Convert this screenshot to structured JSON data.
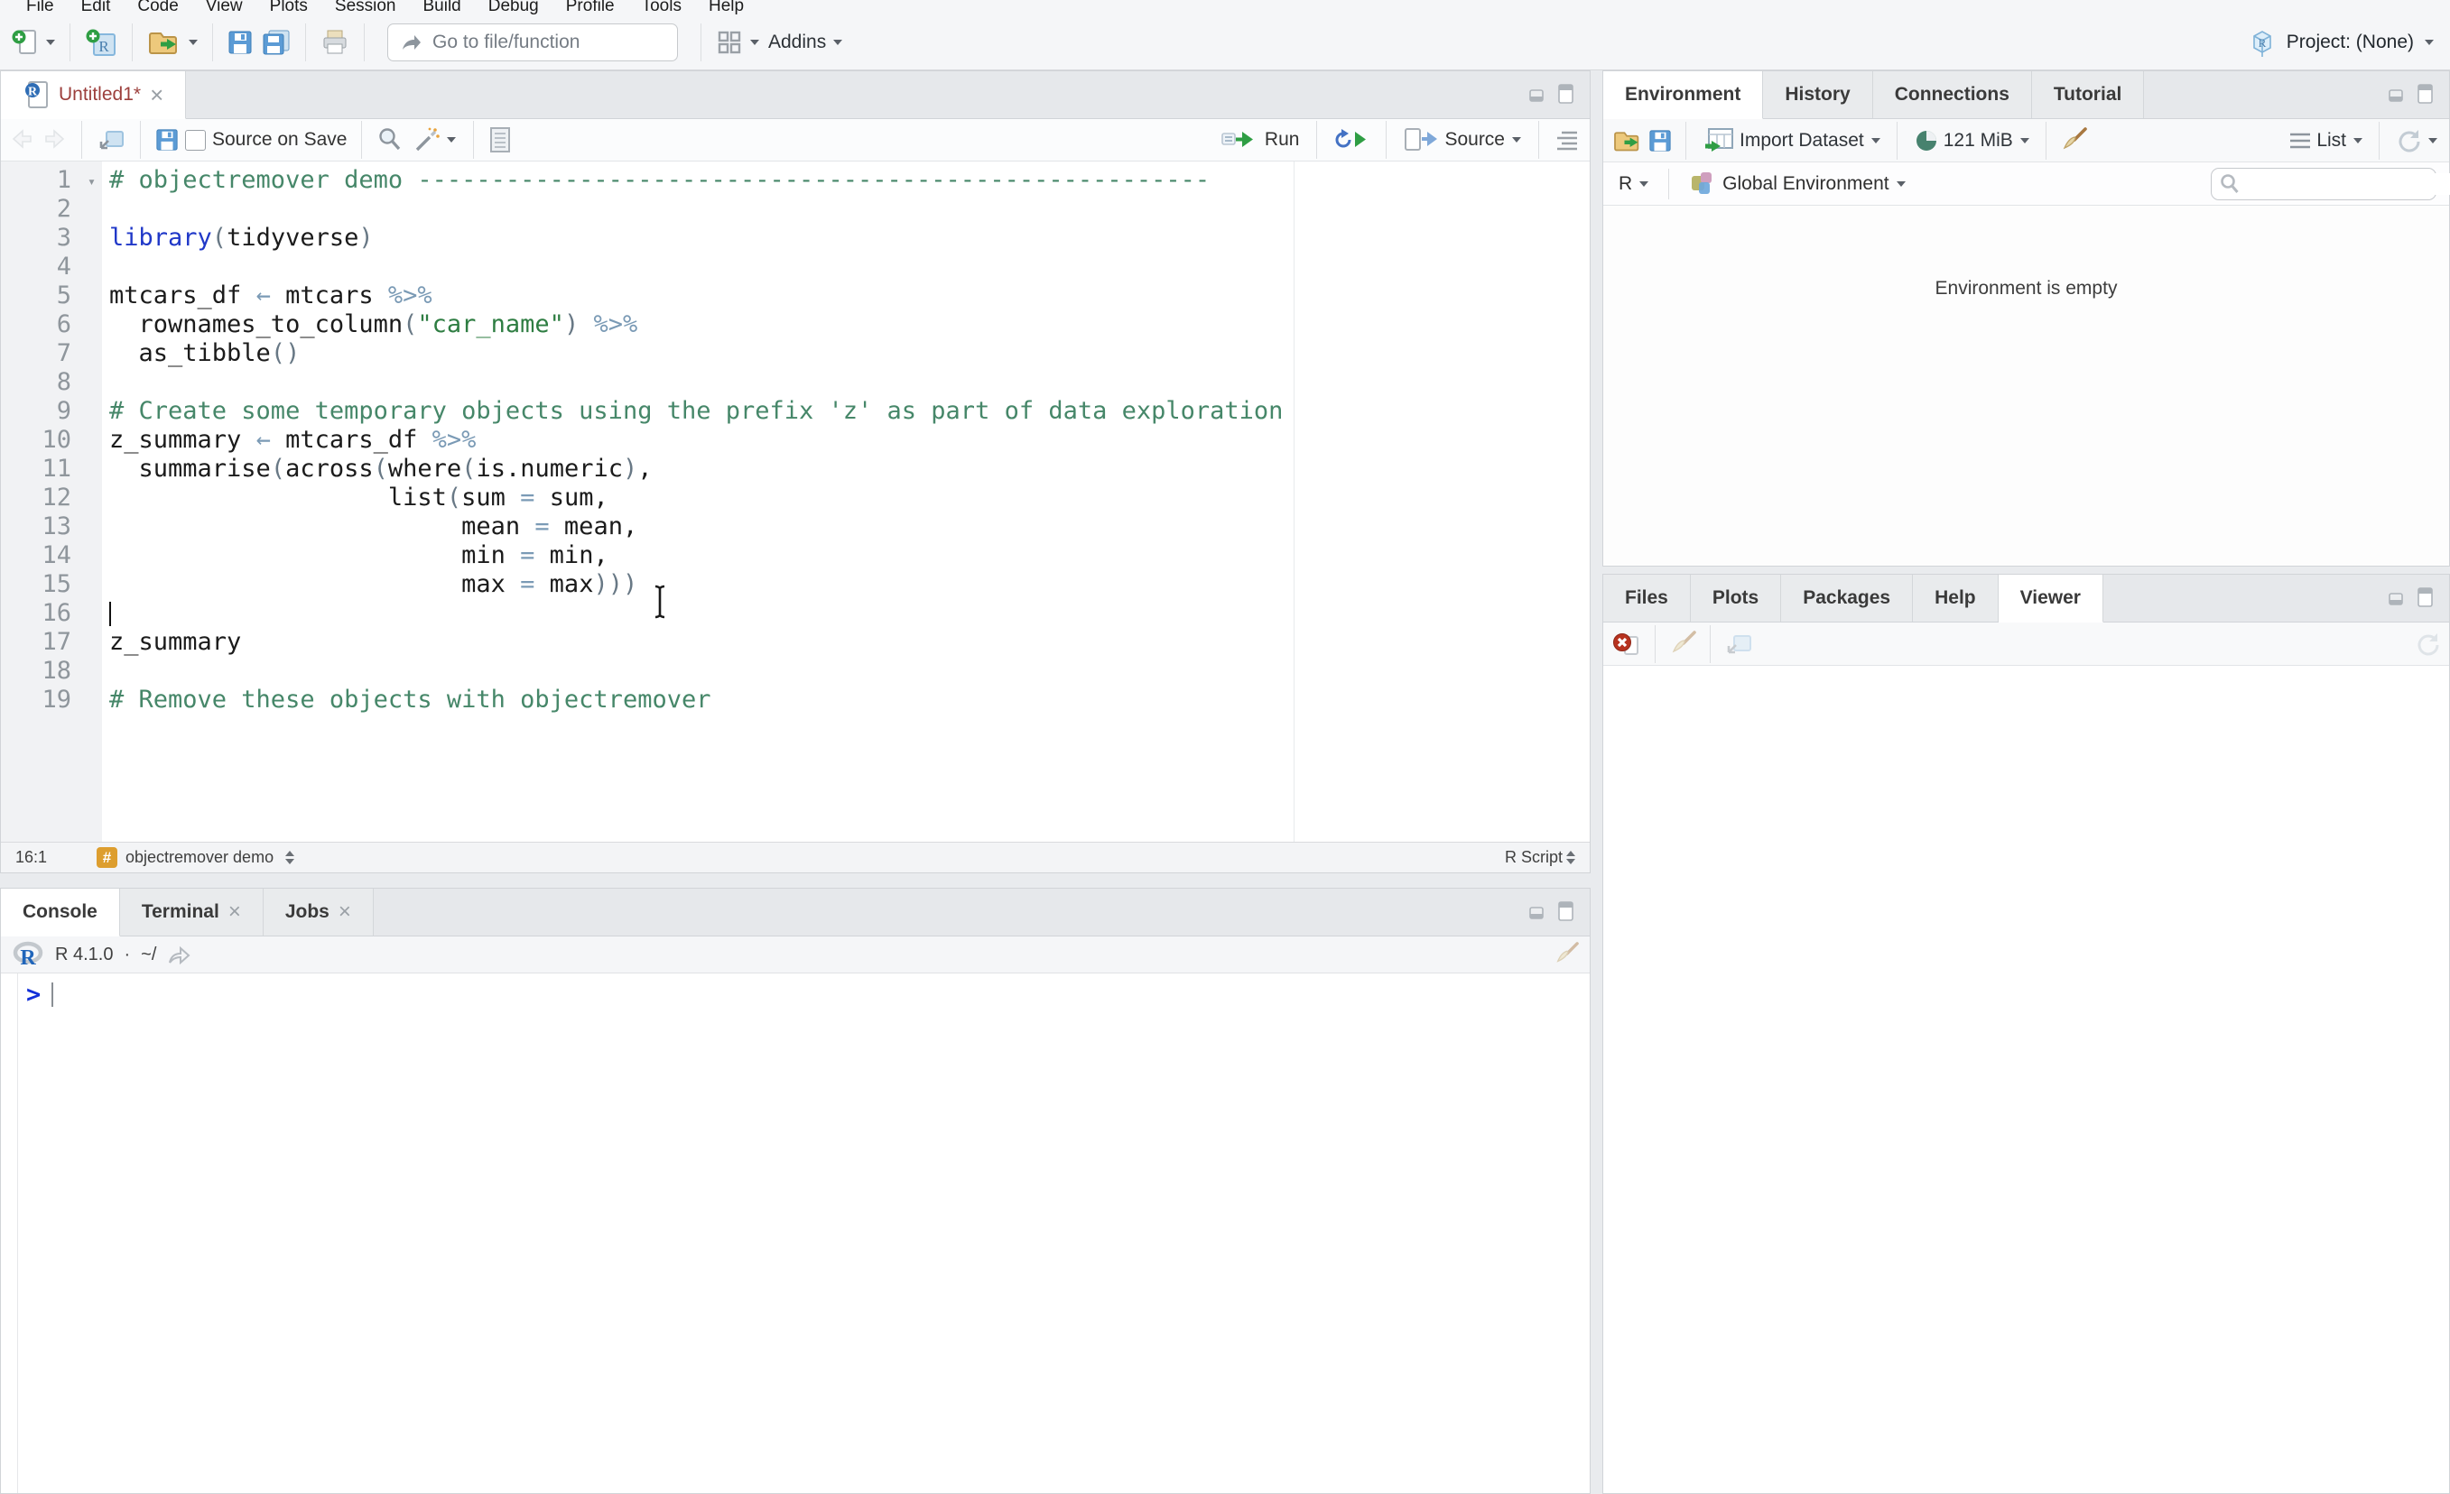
{
  "colors": {
    "chrome_bg": "#f5f6f8",
    "tabstrip_bg": "#e6e8eb",
    "pane_border": "#d1d4d8",
    "comment_green": "#468769",
    "string_green": "#2e7d42",
    "keyword_blue": "#2038c8",
    "operator_blue_gray": "#7a9ab5",
    "paren_gray": "#687885",
    "prompt_blue": "#1330d9",
    "modified_tab_red": "#9c3f3c",
    "section_badge_orange": "#dd9e2f",
    "run_green": "#2f9e44",
    "save_blue": "#5b9bd5"
  },
  "menu_bar": {
    "items": [
      "File",
      "Edit",
      "Code",
      "View",
      "Plots",
      "Session",
      "Build",
      "Debug",
      "Profile",
      "Tools",
      "Help"
    ]
  },
  "main_toolbar": {
    "go_to_file": {
      "placeholder": "Go to file/function"
    },
    "addins_label": "Addins",
    "project_label": "Project: (None)",
    "icons": [
      "new-file-icon",
      "dropdown-caret",
      "new-project-icon",
      "open-file-icon",
      "save-icon",
      "save-all-icon",
      "print-icon",
      "goto-arrow-icon",
      "addins-grid-icon",
      "project-cube-icon"
    ]
  },
  "editor": {
    "tab_title": "Untitled1*",
    "toolbar": {
      "source_on_save_label": "Source on Save",
      "run_label": "Run",
      "source_label": "Source"
    },
    "icons": [
      "r-file-icon",
      "close-icon",
      "back-arrow-icon",
      "forward-arrow-icon",
      "popout-icon",
      "save-icon",
      "source-on-save-checkbox",
      "find-icon",
      "magic-wand-icon",
      "compile-notebook-icon",
      "run-icon",
      "rerun-icon",
      "source-icon",
      "outline-icon",
      "minimize-icon",
      "maximize-icon",
      "fold-arrow-icon"
    ],
    "code_lines": [
      {
        "n": 1,
        "fold": true,
        "tokens": [
          [
            "c",
            "# objectremover demo ------------------------------------------------------"
          ]
        ]
      },
      {
        "n": 2,
        "tokens": []
      },
      {
        "n": 3,
        "tokens": [
          [
            "k",
            "library"
          ],
          [
            "p",
            "("
          ],
          [
            "t",
            "tidyverse"
          ],
          [
            "p",
            ")"
          ]
        ]
      },
      {
        "n": 4,
        "tokens": []
      },
      {
        "n": 5,
        "tokens": [
          [
            "t",
            "mtcars_df "
          ],
          [
            "o",
            "←"
          ],
          [
            "t",
            " mtcars "
          ],
          [
            "o",
            "%>%"
          ]
        ]
      },
      {
        "n": 6,
        "tokens": [
          [
            "t",
            "  rownames_to_column"
          ],
          [
            "p",
            "("
          ],
          [
            "s",
            "\"car_name\""
          ],
          [
            "p",
            ")"
          ],
          [
            "t",
            " "
          ],
          [
            "o",
            "%>%"
          ]
        ]
      },
      {
        "n": 7,
        "tokens": [
          [
            "t",
            "  as_tibble"
          ],
          [
            "p",
            "()"
          ]
        ]
      },
      {
        "n": 8,
        "tokens": []
      },
      {
        "n": 9,
        "tokens": [
          [
            "c",
            "# Create some temporary objects using the prefix 'z' as part of data exploration"
          ]
        ]
      },
      {
        "n": 10,
        "tokens": [
          [
            "t",
            "z_summary "
          ],
          [
            "o",
            "←"
          ],
          [
            "t",
            " mtcars_df "
          ],
          [
            "o",
            "%>%"
          ]
        ]
      },
      {
        "n": 11,
        "tokens": [
          [
            "t",
            "  summarise"
          ],
          [
            "p",
            "("
          ],
          [
            "t",
            "across"
          ],
          [
            "p",
            "("
          ],
          [
            "t",
            "where"
          ],
          [
            "p",
            "("
          ],
          [
            "t",
            "is.numeric"
          ],
          [
            "p",
            ")"
          ],
          [
            "t",
            ","
          ]
        ]
      },
      {
        "n": 12,
        "tokens": [
          [
            "t",
            "                   list"
          ],
          [
            "p",
            "("
          ],
          [
            "t",
            "sum "
          ],
          [
            "o",
            "="
          ],
          [
            "t",
            " sum,"
          ]
        ]
      },
      {
        "n": 13,
        "tokens": [
          [
            "t",
            "                        mean "
          ],
          [
            "o",
            "="
          ],
          [
            "t",
            " mean,"
          ]
        ]
      },
      {
        "n": 14,
        "tokens": [
          [
            "t",
            "                        min "
          ],
          [
            "o",
            "="
          ],
          [
            "t",
            " min,"
          ]
        ]
      },
      {
        "n": 15,
        "tokens": [
          [
            "t",
            "                        max "
          ],
          [
            "o",
            "="
          ],
          [
            "t",
            " max"
          ],
          [
            "p",
            ")))"
          ]
        ]
      },
      {
        "n": 16,
        "cursor": true,
        "tokens": []
      },
      {
        "n": 17,
        "tokens": [
          [
            "t",
            "z_summary"
          ]
        ]
      },
      {
        "n": 18,
        "tokens": []
      },
      {
        "n": 19,
        "tokens": [
          [
            "c",
            "# Remove these objects with objectremover"
          ]
        ]
      }
    ],
    "status": {
      "cursor_position": "16:1",
      "section_label": "objectremover demo",
      "file_type_label": "R Script"
    }
  },
  "console": {
    "tabs": [
      {
        "label": "Console",
        "active": true
      },
      {
        "label": "Terminal",
        "closable": true
      },
      {
        "label": "Jobs",
        "closable": true
      }
    ],
    "version_label": "R 4.1.0",
    "separator": "·",
    "path_label": "~/",
    "prompt": ">",
    "icons": [
      "r-logo-icon",
      "share-arrow-icon",
      "clear-console-icon",
      "minimize-icon",
      "maximize-icon"
    ]
  },
  "environment": {
    "tabs": [
      {
        "label": "Environment",
        "active": true
      },
      {
        "label": "History"
      },
      {
        "label": "Connections"
      },
      {
        "label": "Tutorial"
      }
    ],
    "toolbar": {
      "import_label": "Import Dataset",
      "memory_label": "121 MiB",
      "list_label": "List"
    },
    "scope": {
      "language": "R",
      "environment_label": "Global Environment"
    },
    "search": {
      "placeholder": ""
    },
    "empty_message": "Environment is empty",
    "icons": [
      "open-file-icon",
      "save-icon",
      "import-table-icon",
      "memory-pie-icon",
      "broom-icon",
      "list-icon",
      "refresh-icon",
      "global-env-cubes-icon",
      "search-icon",
      "minimize-icon",
      "maximize-icon"
    ]
  },
  "files_pane": {
    "tabs": [
      {
        "label": "Files"
      },
      {
        "label": "Plots"
      },
      {
        "label": "Packages"
      },
      {
        "label": "Help"
      },
      {
        "label": "Viewer",
        "active": true
      }
    ],
    "icons": [
      "stop-icon",
      "broom-icon",
      "popout-icon",
      "refresh-icon",
      "minimize-icon",
      "maximize-icon"
    ]
  },
  "pointer": {
    "icons": [
      "ibeam-cursor"
    ]
  }
}
